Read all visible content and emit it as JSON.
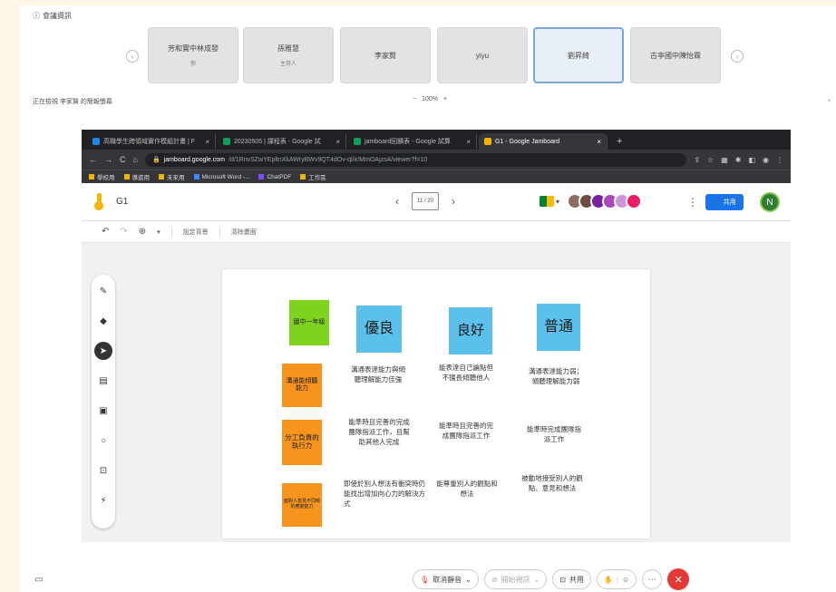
{
  "meeting": {
    "title": "會議資訊"
  },
  "participants": [
    {
      "name": "芳和實中林成發",
      "sub": "你"
    },
    {
      "name": "孫雅慧",
      "sub": "主持人"
    },
    {
      "name": "李家賢",
      "sub": ""
    },
    {
      "name": "yiyu",
      "sub": ""
    },
    {
      "name": "劉昇綺",
      "sub": ""
    },
    {
      "name": "古亭國中陳怡霖",
      "sub": ""
    }
  ],
  "status_text": "正在檢視 李家賢 的簡報螢幕",
  "zoom": {
    "minus": "−",
    "level": "100%",
    "plus": "+"
  },
  "browser": {
    "tabs": [
      {
        "title": "高職學生跨領域實作模組計畫 | F",
        "color": "#1e88e5"
      },
      {
        "title": "20230505 | 課程表 - Google 試",
        "color": "#0f9d58"
      },
      {
        "title": "jamboard回饋表 - Google 試算",
        "color": "#0f9d58"
      },
      {
        "title": "G1 - Google Jamboard",
        "color": "#f4b400"
      }
    ],
    "url_host": "jamboard.google.com",
    "url_path": "/d/1RnvSZwYEpltnXkAWryBWv9QT4dOv-ql/ir/MmOAjzsA/viewer?f=10",
    "bookmarks": [
      "學校用",
      "導遊用",
      "未來用",
      "Microsoft Word -...",
      "ChatPDF",
      "工作區"
    ]
  },
  "jamboard": {
    "title": "G1",
    "page_indicator": "11 / 20",
    "toolbar": {
      "set_background": "設定背景",
      "clear_frame": "清除畫面"
    },
    "share_label": "共用",
    "user_initial": "N",
    "notes": {
      "grade": "國中一年級",
      "excellent": "優良",
      "good": "良好",
      "average": "普通",
      "row1": "溝通能傾聽能力",
      "row2": "分工負責的執行力",
      "row3": "面對人意見不同時的應變能力"
    },
    "handwriting": {
      "r1c1": "溝通表達能力與傾聽理解能力佳強",
      "r1c2": "能表達自己論點但不擅長傾聽他人",
      "r1c3": "溝通表達能力弱；傾聽理解能力弱",
      "r2c1": "能準時且完善的完成團隊指派工作，且幫助其他人完成",
      "r2c2": "能準時且完善的完成團隊指派工作",
      "r2c3": "能準時完成團隊指派工作",
      "r3c1": "即使於別人想法有衝突時仍能找出增加向心力的解決方式",
      "r3c2": "能尊重別人的觀點和想法",
      "r3c3": "被動地接受別人的觀點、意見和想法"
    }
  },
  "controls": {
    "mute_label": "取消靜音",
    "camera_label": "開始視訊",
    "share_label": "共用"
  },
  "colors": {
    "note_green": "#7ed321",
    "note_blue": "#5bc0eb",
    "note_orange": "#f7941d",
    "end_call": "#e53935",
    "share_blue": "#1a73e8"
  }
}
